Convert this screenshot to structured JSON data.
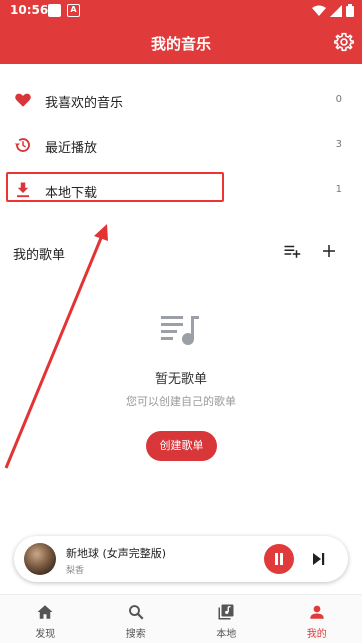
{
  "status_bar": {
    "time": "10:56",
    "left_icons": [
      "notification-square",
      "a-badge"
    ],
    "right_icons": [
      "wifi-icon",
      "signal-icon",
      "battery-icon"
    ]
  },
  "header": {
    "title": "我的音乐",
    "settings_icon": "gear-icon"
  },
  "library": {
    "items": [
      {
        "label": "我喜欢的音乐",
        "count": "0",
        "icon": "heart-icon"
      },
      {
        "label": "最近播放",
        "count": "3",
        "icon": "history-icon"
      },
      {
        "label": "本地下载",
        "count": "1",
        "icon": "download-icon"
      }
    ]
  },
  "playlists": {
    "title": "我的歌单",
    "empty_title": "暂无歌单",
    "empty_subtitle": "您可以创建自己的歌单",
    "create_button": "创建歌单"
  },
  "player": {
    "song": "新地球 (女声完整版)",
    "artist": "梨香"
  },
  "tabs": [
    {
      "label": "发现",
      "icon": "home-icon",
      "active": false
    },
    {
      "label": "搜索",
      "icon": "search-icon",
      "active": false
    },
    {
      "label": "本地",
      "icon": "library-music-icon",
      "active": false
    },
    {
      "label": "我的",
      "icon": "person-icon",
      "active": true
    }
  ],
  "colors": {
    "accent": "#e03a3a",
    "annotation": "#e33333"
  }
}
